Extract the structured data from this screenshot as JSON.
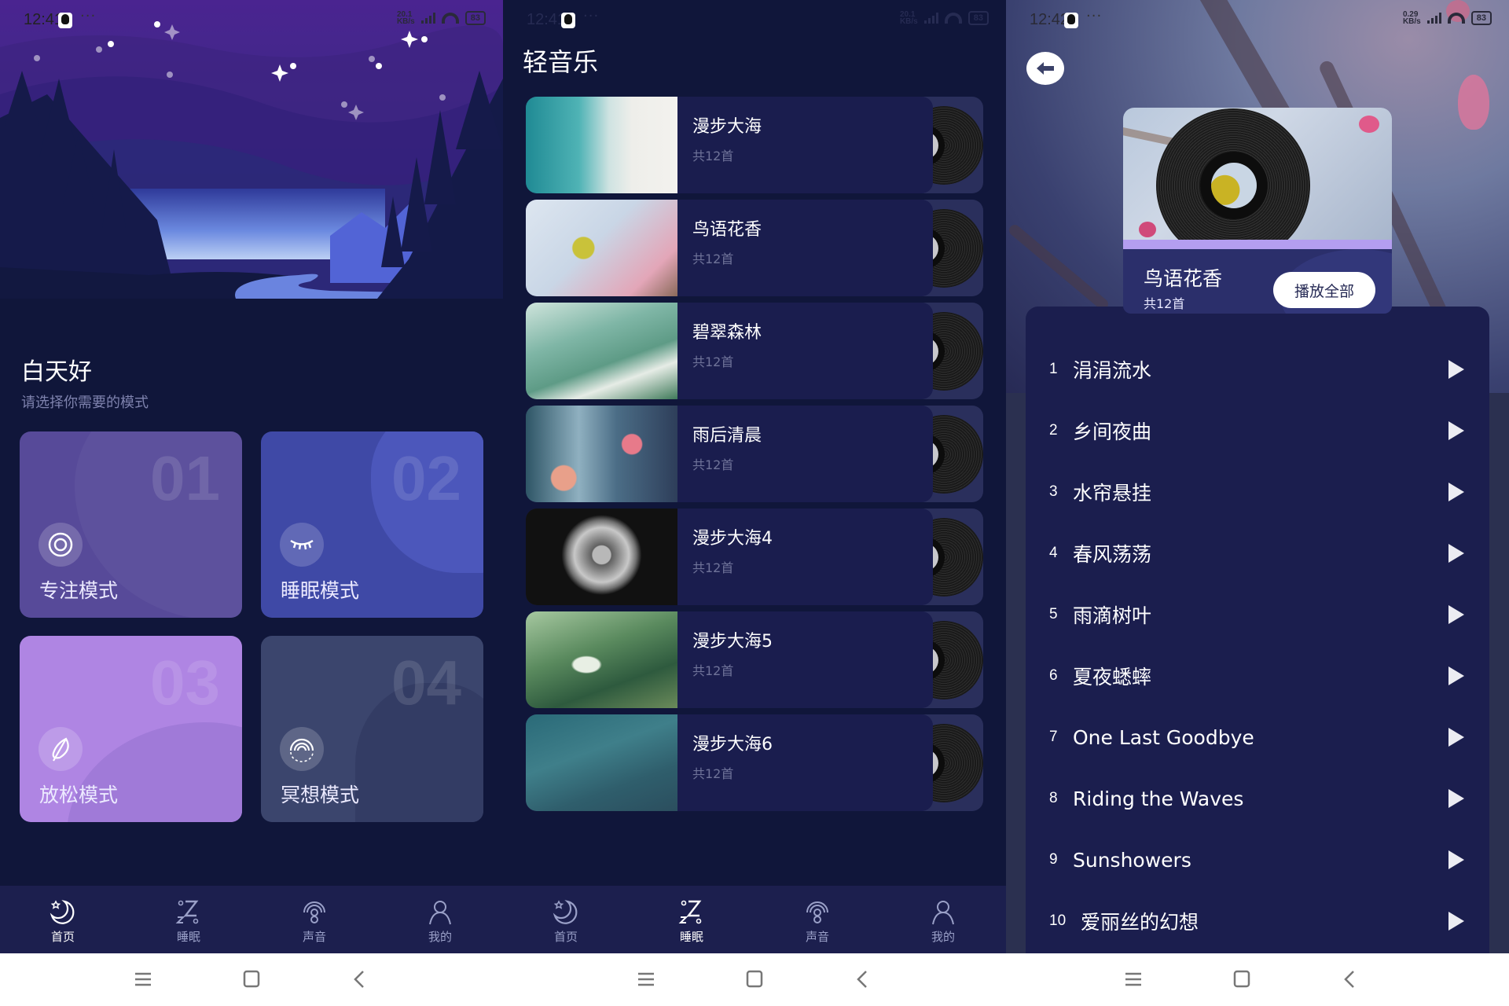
{
  "screens": [
    {
      "status": {
        "time": "12:41",
        "speed_top": "20.1",
        "speed_unit": "KB/s",
        "battery": "83"
      },
      "greeting": "白天好",
      "subtitle": "请选择你需要的模式",
      "modes": [
        {
          "num": "01",
          "label": "专注模式",
          "icon": "target-icon",
          "color": "#574a99"
        },
        {
          "num": "02",
          "label": "睡眠模式",
          "icon": "closed-eye-icon",
          "color": "#3f49a6"
        },
        {
          "num": "03",
          "label": "放松模式",
          "icon": "leaf-icon",
          "color": "#af85e3"
        },
        {
          "num": "04",
          "label": "冥想模式",
          "icon": "meditation-icon",
          "color": "#3b456d"
        }
      ],
      "active_tab": 0
    },
    {
      "status": {
        "time": "12:41",
        "speed_top": "20.1",
        "speed_unit": "KB/s",
        "battery": "83"
      },
      "title": "轻音乐",
      "albums": [
        {
          "name": "漫步大海",
          "count": "共12首",
          "image": "ocean-beach"
        },
        {
          "name": "鸟语花香",
          "count": "共12首",
          "image": "bird-blossom"
        },
        {
          "name": "碧翠森林",
          "count": "共12首",
          "image": "green-forest"
        },
        {
          "name": "雨后清晨",
          "count": "共12首",
          "image": "rain-window"
        },
        {
          "name": "漫步大海4",
          "count": "共12首",
          "image": "dandelion"
        },
        {
          "name": "漫步大海5",
          "count": "共12首",
          "image": "frosted-leaf"
        },
        {
          "name": "漫步大海6",
          "count": "共12首",
          "image": "starry-sky"
        }
      ],
      "active_tab": 1
    },
    {
      "status": {
        "time": "12:42",
        "speed_top": "0.29",
        "speed_unit": "KB/s",
        "battery": "83"
      },
      "album": {
        "title": "鸟语花香",
        "count": "共12首",
        "play_all": "播放全部"
      },
      "tracks": [
        {
          "n": "1",
          "name": "涓涓流水"
        },
        {
          "n": "2",
          "name": "乡间夜曲"
        },
        {
          "n": "3",
          "name": "水帘悬挂"
        },
        {
          "n": "4",
          "name": "春风荡荡"
        },
        {
          "n": "5",
          "name": "雨滴树叶"
        },
        {
          "n": "6",
          "name": "夏夜蟋蟀"
        },
        {
          "n": "7",
          "name": "One Last Goodbye"
        },
        {
          "n": "8",
          "name": "Riding the Waves"
        },
        {
          "n": "9",
          "name": "Sunshowers"
        },
        {
          "n": "10",
          "name": "爱丽丝的幻想"
        }
      ]
    }
  ],
  "tabs": [
    {
      "label": "首页",
      "icon": "moon-star-icon"
    },
    {
      "label": "睡眠",
      "icon": "sleep-zz-icon"
    },
    {
      "label": "声音",
      "icon": "sound-signal-icon"
    },
    {
      "label": "我的",
      "icon": "user-icon"
    }
  ],
  "navbar": [
    "menu-icon",
    "home-square-icon",
    "back-chevron-icon"
  ],
  "colors": {
    "bg": "#10163a",
    "tabbar": "#1c1f4e",
    "card": "#1a1d4e",
    "accent_strip": "#b49ef0"
  }
}
